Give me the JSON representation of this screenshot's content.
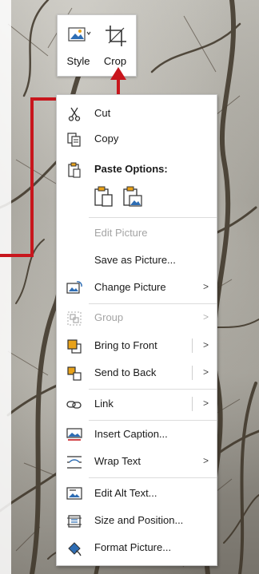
{
  "mini_toolbar": {
    "style_label": "Style",
    "crop_label": "Crop",
    "style_icon": "picture-style-icon",
    "crop_icon": "crop-icon"
  },
  "context_menu": {
    "items": [
      {
        "label": "Cut",
        "icon": "scissors-icon",
        "enabled": true
      },
      {
        "label": "Copy",
        "icon": "copy-icon",
        "enabled": true
      },
      {
        "label": "Paste Options:",
        "icon": "clipboard-icon",
        "enabled": true
      },
      {
        "label": "Edit Picture",
        "icon": "",
        "enabled": false
      },
      {
        "label": "Save as Picture...",
        "icon": "",
        "enabled": true
      },
      {
        "label": "Change Picture",
        "icon": "change-picture-icon",
        "enabled": true,
        "submenu": true
      },
      {
        "label": "Group",
        "icon": "group-icon",
        "enabled": false,
        "submenu": true
      },
      {
        "label": "Bring to Front",
        "icon": "bring-to-front-icon",
        "enabled": true,
        "submenu": true
      },
      {
        "label": "Send to Back",
        "icon": "send-to-back-icon",
        "enabled": true,
        "submenu": true
      },
      {
        "label": "Link",
        "icon": "link-icon",
        "enabled": true,
        "submenu": true
      },
      {
        "label": "Insert Caption...",
        "icon": "insert-caption-icon",
        "enabled": true
      },
      {
        "label": "Wrap Text",
        "icon": "wrap-text-icon",
        "enabled": true,
        "submenu": true
      },
      {
        "label": "Edit Alt Text...",
        "icon": "alt-text-icon",
        "enabled": true
      },
      {
        "label": "Size and Position...",
        "icon": "size-position-icon",
        "enabled": true
      },
      {
        "label": "Format Picture...",
        "icon": "format-picture-icon",
        "enabled": true
      }
    ],
    "paste_options": [
      "paste-keep-source-icon",
      "paste-picture-icon"
    ],
    "submenu_arrow": ">"
  },
  "colors": {
    "callout": "#c8161d",
    "icon_blue": "#2e6db4",
    "icon_orange": "#e8a21a",
    "disabled_text": "#a4a4a4"
  }
}
